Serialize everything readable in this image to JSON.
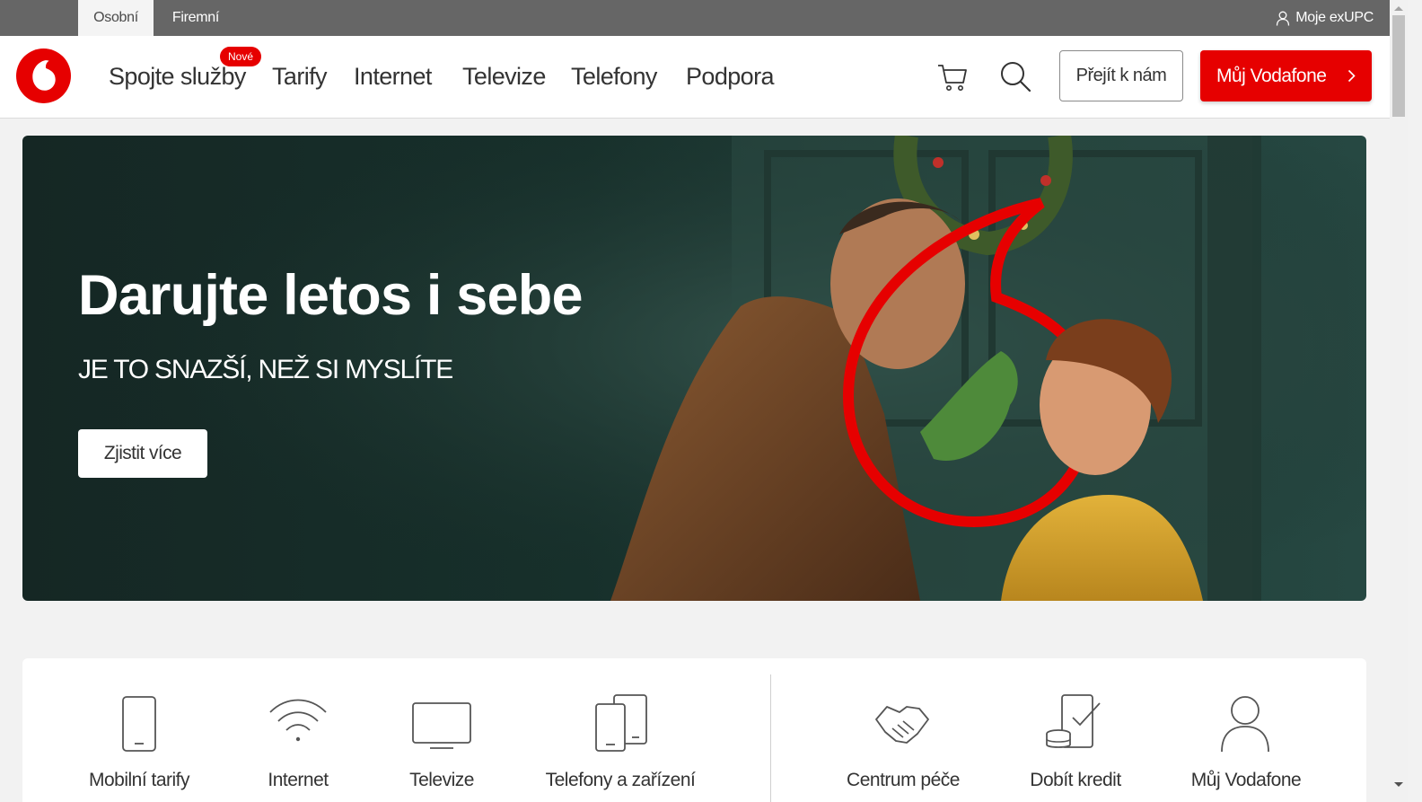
{
  "top_bar": {
    "tabs": [
      {
        "label": "Osobní",
        "active": true
      },
      {
        "label": "Firemní",
        "active": false
      }
    ],
    "account_link": "Moje exUPC"
  },
  "header": {
    "nav": [
      {
        "label": "Spojte služby",
        "badge": "Nové"
      },
      {
        "label": "Tarify"
      },
      {
        "label": "Internet"
      },
      {
        "label": "Televize"
      },
      {
        "label": "Telefony"
      },
      {
        "label": "Podpora"
      }
    ],
    "cart_icon": "cart-icon",
    "search_icon": "search-icon",
    "contact_button": "Přejít k nám",
    "my_vodafone_button": "Můj Vodafone"
  },
  "hero": {
    "title": "Darujte letos i sebe",
    "subtitle": "JE TO SNAZŠÍ, NEŽ SI MYSLÍTE",
    "button": "Zjistit více"
  },
  "quick_links": [
    {
      "label": "Mobilní tarify",
      "icon": "smartphone-icon"
    },
    {
      "label": "Internet",
      "icon": "wifi-icon"
    },
    {
      "label": "Televize",
      "icon": "tv-icon"
    },
    {
      "label": "Telefony a zařízení",
      "icon": "devices-icon"
    },
    {
      "label": "Centrum péče",
      "icon": "handshake-icon"
    },
    {
      "label": "Dobít kredit",
      "icon": "top-up-icon"
    },
    {
      "label": "Můj Vodafone",
      "icon": "user-icon"
    }
  ],
  "colors": {
    "brand_red": "#e60000",
    "top_bar": "#666666",
    "hero_background": "#17302b"
  }
}
